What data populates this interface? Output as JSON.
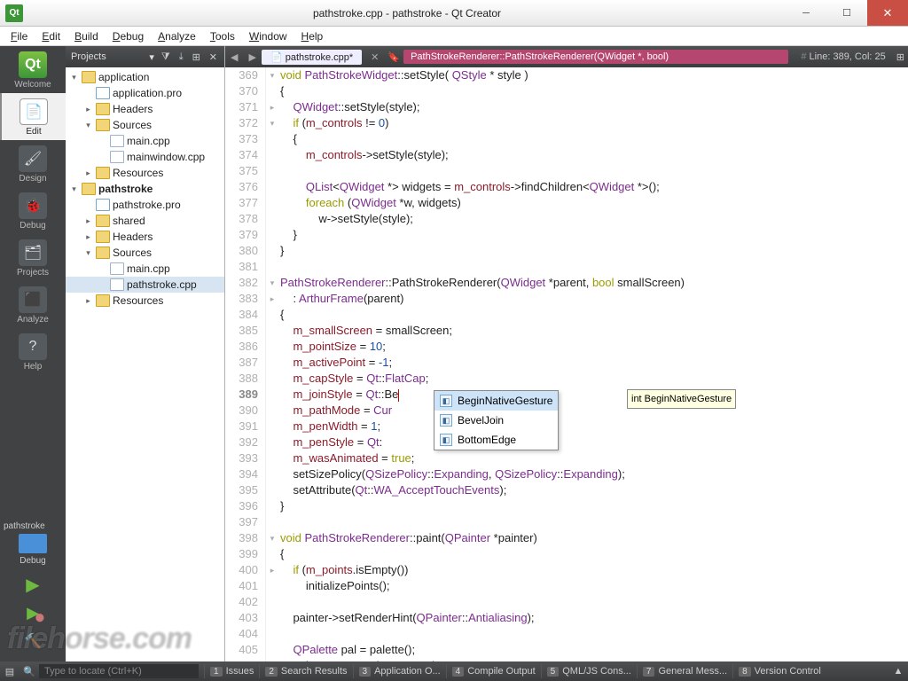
{
  "window": {
    "title": "pathstroke.cpp - pathstroke - Qt Creator"
  },
  "menu": [
    "File",
    "Edit",
    "Build",
    "Debug",
    "Analyze",
    "Tools",
    "Window",
    "Help"
  ],
  "modes": [
    {
      "id": "welcome",
      "label": "Welcome"
    },
    {
      "id": "edit",
      "label": "Edit"
    },
    {
      "id": "design",
      "label": "Design"
    },
    {
      "id": "debug",
      "label": "Debug"
    },
    {
      "id": "projects",
      "label": "Projects"
    },
    {
      "id": "analyze",
      "label": "Analyze"
    },
    {
      "id": "help",
      "label": "Help"
    }
  ],
  "kit": {
    "name": "pathstroke",
    "config": "Debug"
  },
  "treeheader": {
    "label": "Projects"
  },
  "tree": [
    {
      "d": 0,
      "exp": "▾",
      "icon": "fproj",
      "label": "application"
    },
    {
      "d": 1,
      "exp": "",
      "icon": "fpro",
      "label": "application.pro"
    },
    {
      "d": 1,
      "exp": "▸",
      "icon": "fhdr",
      "label": "Headers"
    },
    {
      "d": 1,
      "exp": "▾",
      "icon": "fsrc",
      "label": "Sources"
    },
    {
      "d": 2,
      "exp": "",
      "icon": "fcpp",
      "label": "main.cpp"
    },
    {
      "d": 2,
      "exp": "",
      "icon": "fcpp",
      "label": "mainwindow.cpp"
    },
    {
      "d": 1,
      "exp": "▸",
      "icon": "fres",
      "label": "Resources"
    },
    {
      "d": 0,
      "exp": "▾",
      "icon": "fproj",
      "label": "pathstroke",
      "bold": true
    },
    {
      "d": 1,
      "exp": "",
      "icon": "fpro",
      "label": "pathstroke.pro"
    },
    {
      "d": 1,
      "exp": "▸",
      "icon": "fproj",
      "label": "shared"
    },
    {
      "d": 1,
      "exp": "▸",
      "icon": "fhdr",
      "label": "Headers"
    },
    {
      "d": 1,
      "exp": "▾",
      "icon": "fsrc",
      "label": "Sources"
    },
    {
      "d": 2,
      "exp": "",
      "icon": "fcpp",
      "label": "main.cpp"
    },
    {
      "d": 2,
      "exp": "",
      "icon": "fcpp",
      "label": "pathstroke.cpp",
      "sel": true
    },
    {
      "d": 1,
      "exp": "▸",
      "icon": "fres",
      "label": "Resources"
    }
  ],
  "editor": {
    "tab": "pathstroke.cpp",
    "tab_dirty": true,
    "crumb": "PathStrokeRenderer::PathStrokeRenderer(QWidget *, bool)",
    "position": "Line: 389, Col: 25",
    "first_line": 369,
    "current_line": 389,
    "lines": [
      "<span class='kw'>void</span> <span class='ty'>PathStrokeWidget</span>::setStyle( <span class='ty'>QStyle</span> * style )",
      "{",
      "    <span class='ty'>QWidget</span>::setStyle(style);",
      "    <span class='kw'>if</span> (<span class='mem'>m_controls</span> != <span class='num'>0</span>)",
      "    {",
      "        <span class='mem'>m_controls</span>-&gt;setStyle(style);",
      "",
      "        <span class='ty'>QList</span>&lt;<span class='ty'>QWidget</span> *&gt; widgets = <span class='mem'>m_controls</span>-&gt;findChildren&lt;<span class='ty'>QWidget</span> *&gt;();",
      "        <span class='kw'>foreach</span> (<span class='ty'>QWidget</span> *w, widgets)",
      "            w-&gt;setStyle(style);",
      "    }",
      "}",
      "",
      "<span class='ty'>PathStrokeRenderer</span>::PathStrokeRenderer(<span class='ty'>QWidget</span> *parent, <span class='kw'>bool</span> smallScreen)",
      "    : <span class='ty'>ArthurFrame</span>(parent)",
      "{",
      "    <span class='mem'>m_smallScreen</span> = smallScreen;",
      "    <span class='mem'>m_pointSize</span> = <span class='num'>10</span>;",
      "    <span class='mem'>m_activePoint</span> = <span class='num'>-1</span>;",
      "    <span class='mem'>m_capStyle</span> = <span class='ty'>Qt</span>::<span class='ty'>FlatCap</span>;",
      "    <span class='mem'>m_joinStyle</span> = <span class='ty'>Qt</span>::Be<span class='caret'></span>",
      "    <span class='mem'>m_pathMode</span> = <span class='ty'>Cur</span>",
      "    <span class='mem'>m_penWidth</span> = <span class='num'>1</span>;",
      "    <span class='mem'>m_penStyle</span> = <span class='ty'>Qt</span>:",
      "    <span class='mem'>m_wasAnimated</span> = <span class='kw'>true</span>;",
      "    setSizePolicy(<span class='ty'>QSizePolicy</span>::<span class='ty'>Expanding</span>, <span class='ty'>QSizePolicy</span>::<span class='ty'>Expanding</span>);",
      "    setAttribute(<span class='ty'>Qt</span>::<span class='ty'>WA_AcceptTouchEvents</span>);",
      "}",
      "",
      "<span class='kw'>void</span> <span class='ty'>PathStrokeRenderer</span>::paint(<span class='ty'>QPainter</span> *painter)",
      "{",
      "    <span class='kw'>if</span> (<span class='mem'>m_points</span>.isEmpty())",
      "        initializePoints();",
      "",
      "    painter-&gt;setRenderHint(<span class='ty'>QPainter</span>::<span class='ty'>Antialiasing</span>);",
      "",
      "    <span class='ty'>QPalette</span> pal = palette();",
      "    painter-&gt;setPen(<span class='ty'>Qt</span>::<span class='ty'>NoPen</span>);"
    ],
    "fold_markers": {
      "369": "▾",
      "371": "▸",
      "372": "▾",
      "382": "▾",
      "383": "▸",
      "398": "▾",
      "400": "▸"
    }
  },
  "completion": {
    "items": [
      {
        "label": "BeginNativeGesture",
        "sel": true
      },
      {
        "label": "BevelJoin"
      },
      {
        "label": "BottomEdge"
      }
    ],
    "tooltip": "int BeginNativeGesture"
  },
  "locator_placeholder": "Type to locate (Ctrl+K)",
  "outputs": [
    {
      "n": "1",
      "label": "Issues"
    },
    {
      "n": "2",
      "label": "Search Results"
    },
    {
      "n": "3",
      "label": "Application O..."
    },
    {
      "n": "4",
      "label": "Compile Output"
    },
    {
      "n": "5",
      "label": "QML/JS Cons..."
    },
    {
      "n": "7",
      "label": "General Mess..."
    },
    {
      "n": "8",
      "label": "Version Control"
    }
  ],
  "watermark": "filehorse.com"
}
